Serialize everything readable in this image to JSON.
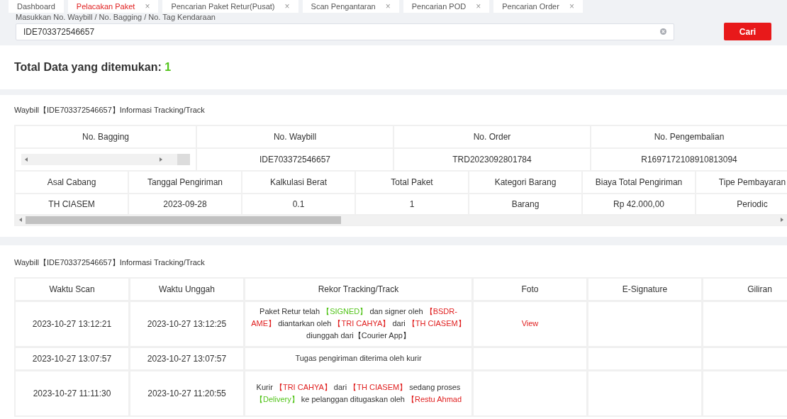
{
  "tabs": [
    {
      "label": "Dashboard",
      "selected": false,
      "closable": false
    },
    {
      "label": "Pelacakan Paket",
      "selected": true,
      "closable": true
    },
    {
      "label": "Pencarian Paket Retur(Pusat)",
      "selected": false,
      "closable": true
    },
    {
      "label": "Scan Pengantaran",
      "selected": false,
      "closable": true
    },
    {
      "label": "Pencarian POD",
      "selected": false,
      "closable": true
    },
    {
      "label": "Pencarian Order",
      "selected": false,
      "closable": true
    }
  ],
  "close_glyph": "×",
  "search": {
    "label": "Masukkan No. Waybill / No. Bagging / No. Tag Kendaraan",
    "value": "IDE703372546657",
    "button": "Cari"
  },
  "summary": {
    "label": "Total Data yang ditemukan:",
    "count": "1"
  },
  "info": {
    "title": "Waybill【IDE703372546657】Informasi Tracking/Track",
    "table1": {
      "columns": [
        "No. Bagging",
        "No. Waybill",
        "No. Order",
        "No. Pengembalian"
      ],
      "row": [
        "IDE703372546657",
        "TRD2023092801784",
        "R1697172108910813094"
      ]
    },
    "table2": {
      "columns": [
        "Asal Cabang",
        "Tanggal Pengiriman",
        "Kalkulasi Berat",
        "Total Paket",
        "Kategori Barang",
        "Biaya Total Pengiriman",
        "Tipe Pembayaran"
      ],
      "row": [
        "TH CIASEM",
        "2023-09-28",
        "0.1",
        "1",
        "Barang",
        "Rp 42.000,00",
        "Periodic"
      ]
    }
  },
  "tracking": {
    "title": "Waybill【IDE703372546657】Informasi Tracking/Track",
    "columns": [
      "Waktu Scan",
      "Waktu Unggah",
      "Rekor Tracking/Track",
      "Foto",
      "E-Signature",
      "Giliran"
    ],
    "rows": [
      {
        "scan": "2023-10-27 13:12:21",
        "upload": "2023-10-27 13:12:25",
        "record": [
          {
            "text": "Paket Retur telah",
            "color": "#333333"
          },
          {
            "text": "【SIGNED】",
            "color": "#52c41a"
          },
          {
            "text": "dan signer oleh",
            "color": "#333333"
          },
          {
            "text": "【BSDR-AME】",
            "color": "#e02020"
          },
          {
            "text": "diantarkan oleh",
            "color": "#333333"
          },
          {
            "text": "【TRI CAHYA】",
            "color": "#e02020"
          },
          {
            "text": "dari",
            "color": "#333333"
          },
          {
            "text": "【TH CIASEM】",
            "color": "#e02020"
          },
          {
            "text": "diunggah dari【Courier App】",
            "color": "#333333"
          }
        ],
        "photo": "View"
      },
      {
        "scan": "2023-10-27 13:07:57",
        "upload": "2023-10-27 13:07:57",
        "record": [
          {
            "text": "Tugas pengiriman diterima oleh kurir",
            "color": "#333333"
          }
        ]
      },
      {
        "scan": "2023-10-27 11:11:30",
        "upload": "2023-10-27 11:20:55",
        "record": [
          {
            "text": "Kurir",
            "color": "#333333"
          },
          {
            "text": "【TRI CAHYA】",
            "color": "#e02020"
          },
          {
            "text": "dari",
            "color": "#333333"
          },
          {
            "text": "【TH CIASEM】",
            "color": "#e02020"
          },
          {
            "text": "sedang proses",
            "color": "#333333"
          },
          {
            "text": "【Delivery】",
            "color": "#52c41a"
          },
          {
            "text": "ke pelanggan ditugaskan oleh",
            "color": "#333333"
          },
          {
            "text": "【Restu Ahmad",
            "color": "#e02020"
          }
        ]
      }
    ]
  }
}
